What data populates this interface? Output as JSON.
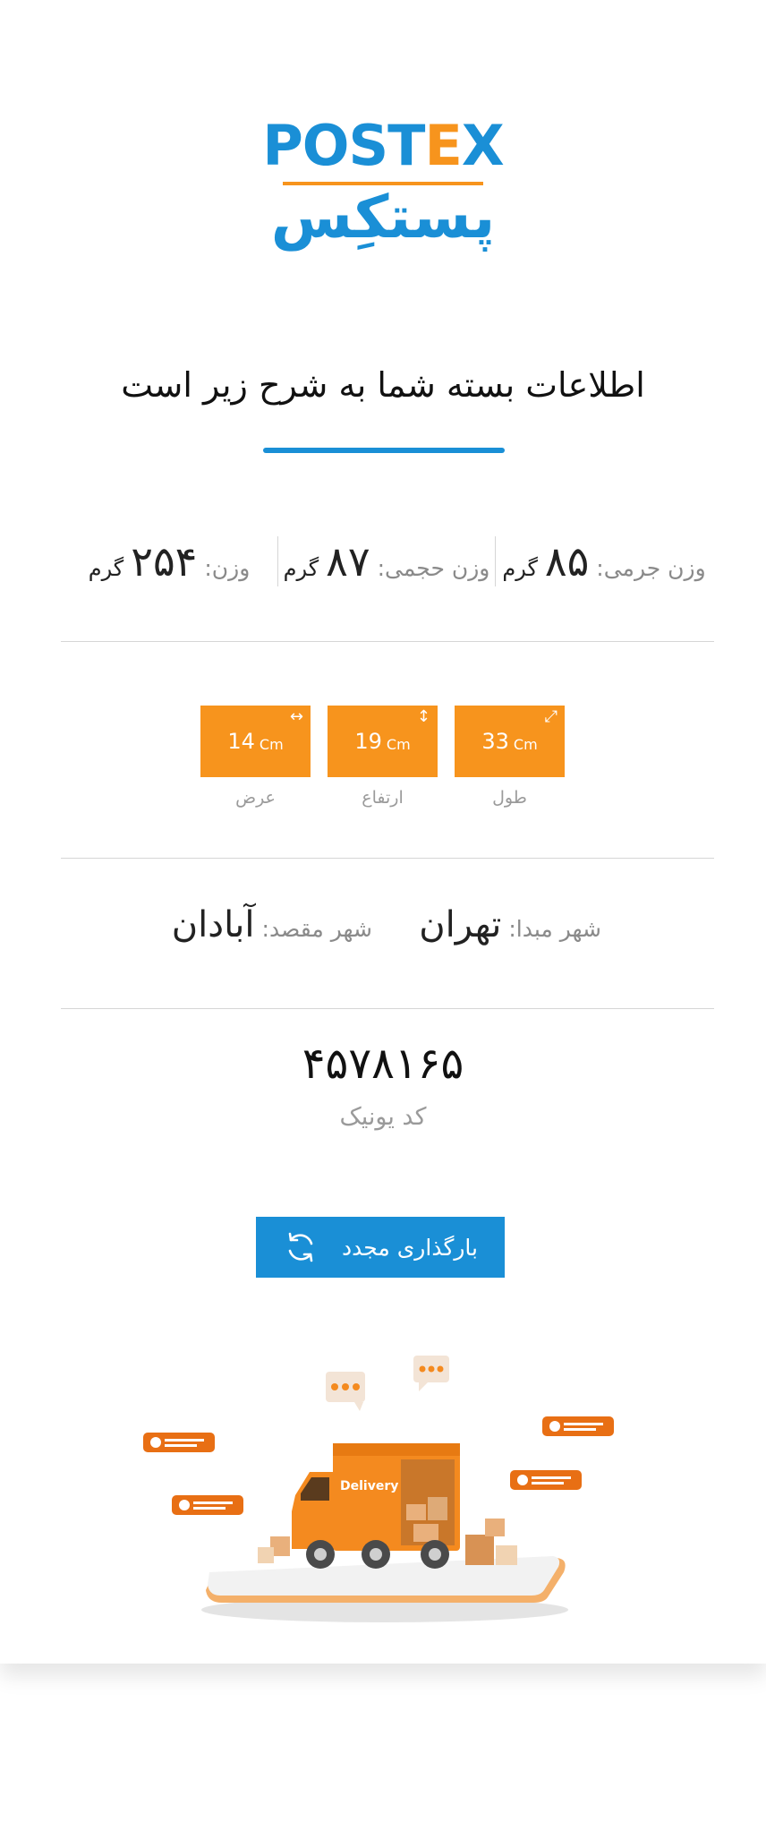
{
  "logo": {
    "en_main": "POST",
    "en_accent": "E",
    "en_tail": "X",
    "fa": "پستکِس"
  },
  "heading": "اطلاعات بسته شما به شرح زیر است",
  "weights": [
    {
      "label": "وزن جرمی:",
      "value": "۸۵",
      "unit": "گرم"
    },
    {
      "label": "وزن حجمی:",
      "value": "۸۷",
      "unit": "گرم"
    },
    {
      "label": "وزن:",
      "value": "۲۵۴",
      "unit": "گرم"
    }
  ],
  "dimensions": [
    {
      "value": "33",
      "unit": "Cm",
      "label": "طول",
      "icon": "diagonal-resize-icon",
      "arrow": "⤢"
    },
    {
      "value": "19",
      "unit": "Cm",
      "label": "ارتفاع",
      "icon": "vertical-resize-icon",
      "arrow": "↕"
    },
    {
      "value": "14",
      "unit": "Cm",
      "label": "عرض",
      "icon": "horizontal-resize-icon",
      "arrow": "↔"
    }
  ],
  "origin": {
    "label": "شهر مبدا:",
    "value": "تهران"
  },
  "destination": {
    "label": "شهر مقصد:",
    "value": "آبادان"
  },
  "unique_code": {
    "value": "۴۵۷۸۱۶۵",
    "label": "کد یونیک"
  },
  "reload_button": {
    "label": "بارگذاری مجدد",
    "icon": "refresh-icon"
  },
  "illustration": {
    "truck_text": "Delivery"
  },
  "colors": {
    "primary": "#1a8fd6",
    "accent": "#f7941d",
    "text": "#222222",
    "muted": "#8a8a8a"
  }
}
